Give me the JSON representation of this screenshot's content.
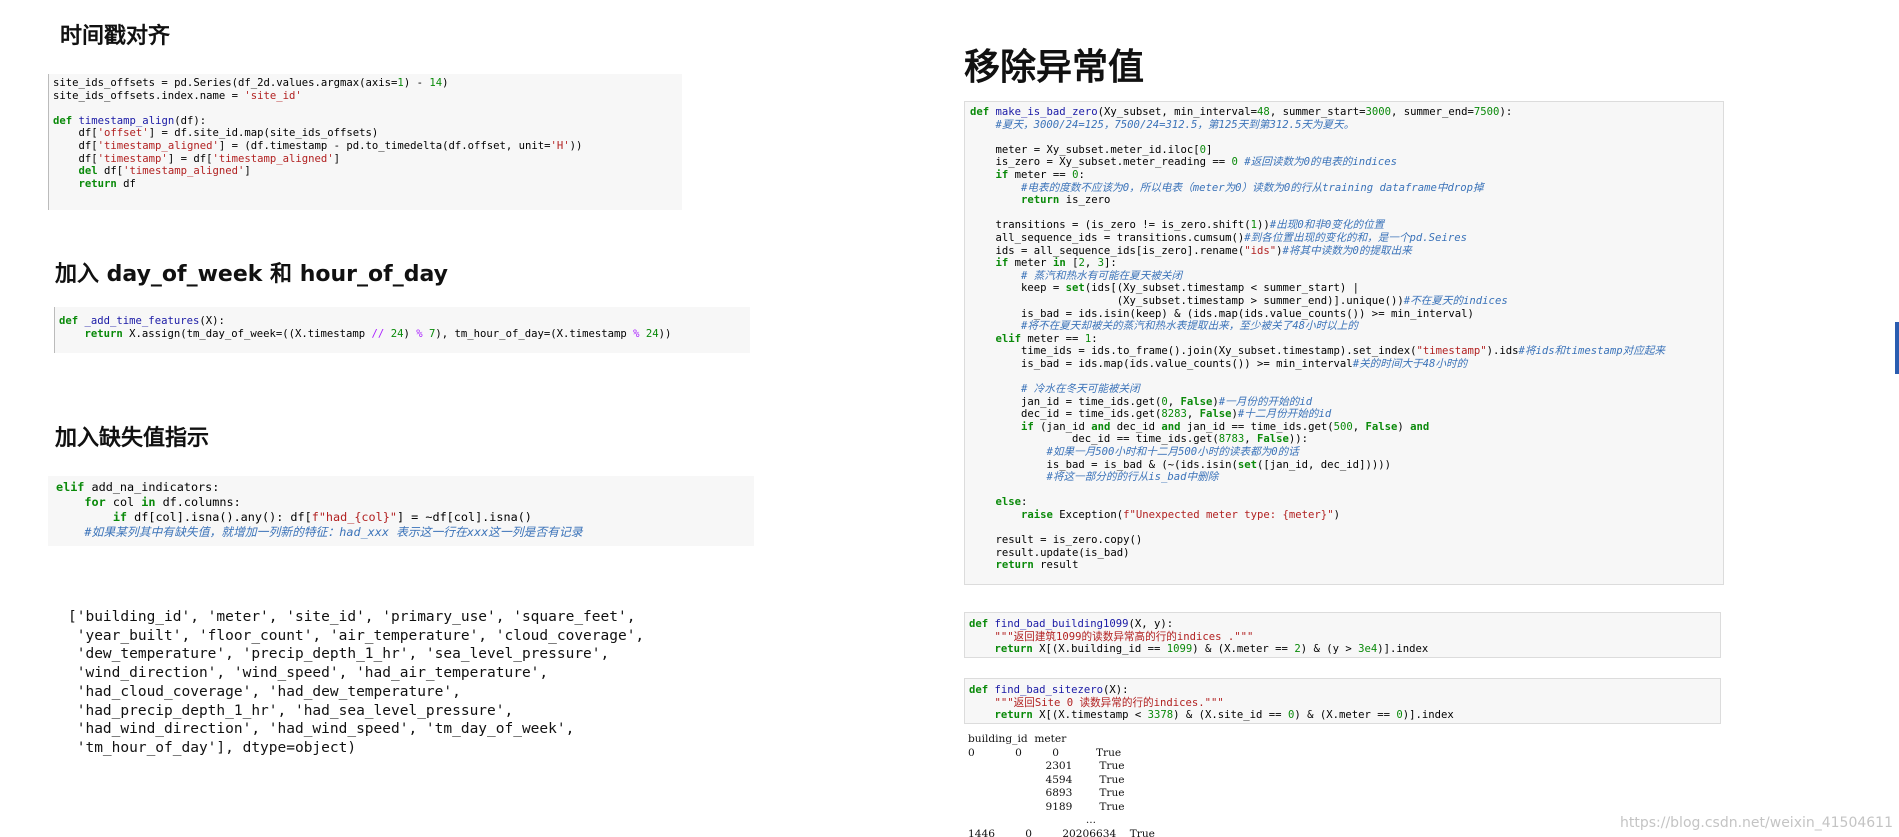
{
  "sections": {
    "timestamp_align": {
      "title": "时间戳对齐"
    },
    "time_features": {
      "title": "加入 day_of_week 和 hour_of_day"
    },
    "na_indicators": {
      "title": "加入缺失值指示"
    },
    "remove_outliers": {
      "title": "移除异常值"
    }
  },
  "columns_output": "['building_id', 'meter', 'site_id', 'primary_use', 'square_feet',\n 'year_built', 'floor_count', 'air_temperature', 'cloud_coverage',\n 'dew_temperature', 'precip_depth_1_hr', 'sea_level_pressure',\n 'wind_direction', 'wind_speed', 'had_air_temperature',\n 'had_cloud_coverage', 'had_dew_temperature',\n 'had_precip_depth_1_hr', 'had_sea_level_pressure',\n 'had_wind_direction', 'had_wind_speed', 'tm_day_of_week',\n 'tm_hour_of_day'], dtype=object)",
  "result_table": "building_id  meter\n0            0         0           True\n                       2301        True\n                       4594        True\n                       6893        True\n                       9189        True\n                                   ...\n1446         0         20206634    True",
  "watermark": "https://blog.csdn.net/weixin_41504611"
}
